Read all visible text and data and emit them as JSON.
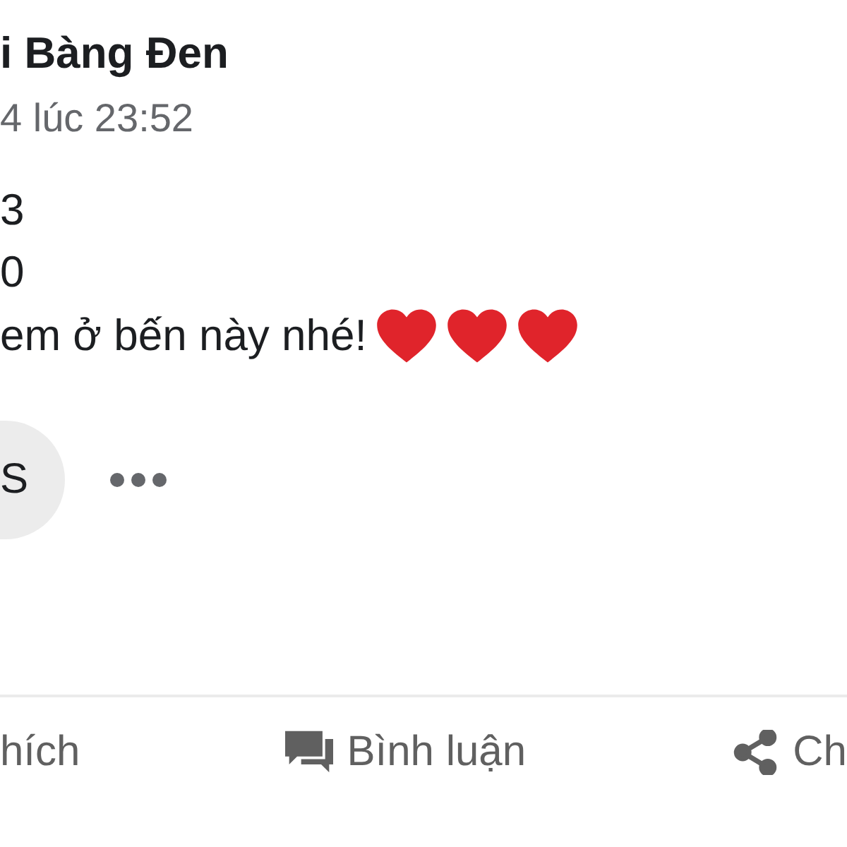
{
  "post": {
    "author": "i Bàng Đen",
    "timestamp": "4 lúc 23:52",
    "lines": [
      "3",
      "0",
      "em ở bến này nhé!"
    ],
    "emoji": [
      {
        "kind": "heart"
      },
      {
        "kind": "heart"
      },
      {
        "kind": "heart"
      }
    ],
    "chip": "S"
  },
  "actions": [
    {
      "kind": "like",
      "label": "hích"
    },
    {
      "kind": "comment",
      "label": "Bình luận"
    },
    {
      "kind": "share",
      "label": "Ch"
    }
  ]
}
